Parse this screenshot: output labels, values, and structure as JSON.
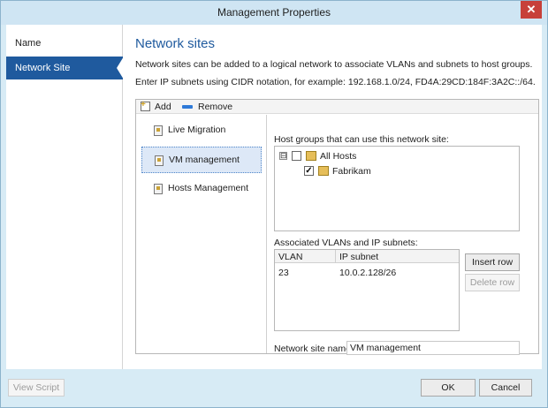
{
  "window": {
    "title": "Management Properties",
    "close_label": "✕"
  },
  "sidebar": {
    "items": [
      {
        "label": "Name"
      },
      {
        "label": "Network Site"
      }
    ]
  },
  "main": {
    "title": "Network sites",
    "desc1": "Network sites can be added to a logical network to associate VLANs and subnets to host groups.",
    "desc2": "Enter IP subnets using CIDR notation, for example: 192.168.1.0/24, FD4A:29CD:184F:3A2C::/64."
  },
  "toolbar": {
    "add_label": "Add",
    "remove_label": "Remove"
  },
  "sites": [
    {
      "label": "Live Migration"
    },
    {
      "label": "VM management"
    },
    {
      "label": "Hosts Management"
    }
  ],
  "host_groups": {
    "label": "Host groups that can use this network site:",
    "root": {
      "label": "All Hosts",
      "expander": "⊟",
      "checked": false
    },
    "child": {
      "label": "Fabrikam",
      "checked": true,
      "check_mark": "✓"
    }
  },
  "vlans": {
    "label": "Associated VLANs and IP subnets:",
    "columns": [
      "VLAN",
      "IP subnet"
    ],
    "rows": [
      {
        "vlan": "23",
        "subnet": "10.0.2.128/26"
      }
    ],
    "insert_label": "Insert row",
    "delete_label": "Delete row"
  },
  "network_site_name": {
    "label": "Network site name:",
    "value": "VM management"
  },
  "footer": {
    "view_script_label": "View Script",
    "ok_label": "OK",
    "cancel_label": "Cancel"
  },
  "colors": {
    "accent": "#1f5a9e",
    "window_bg": "#d7ebf5",
    "close": "#c7403a"
  }
}
